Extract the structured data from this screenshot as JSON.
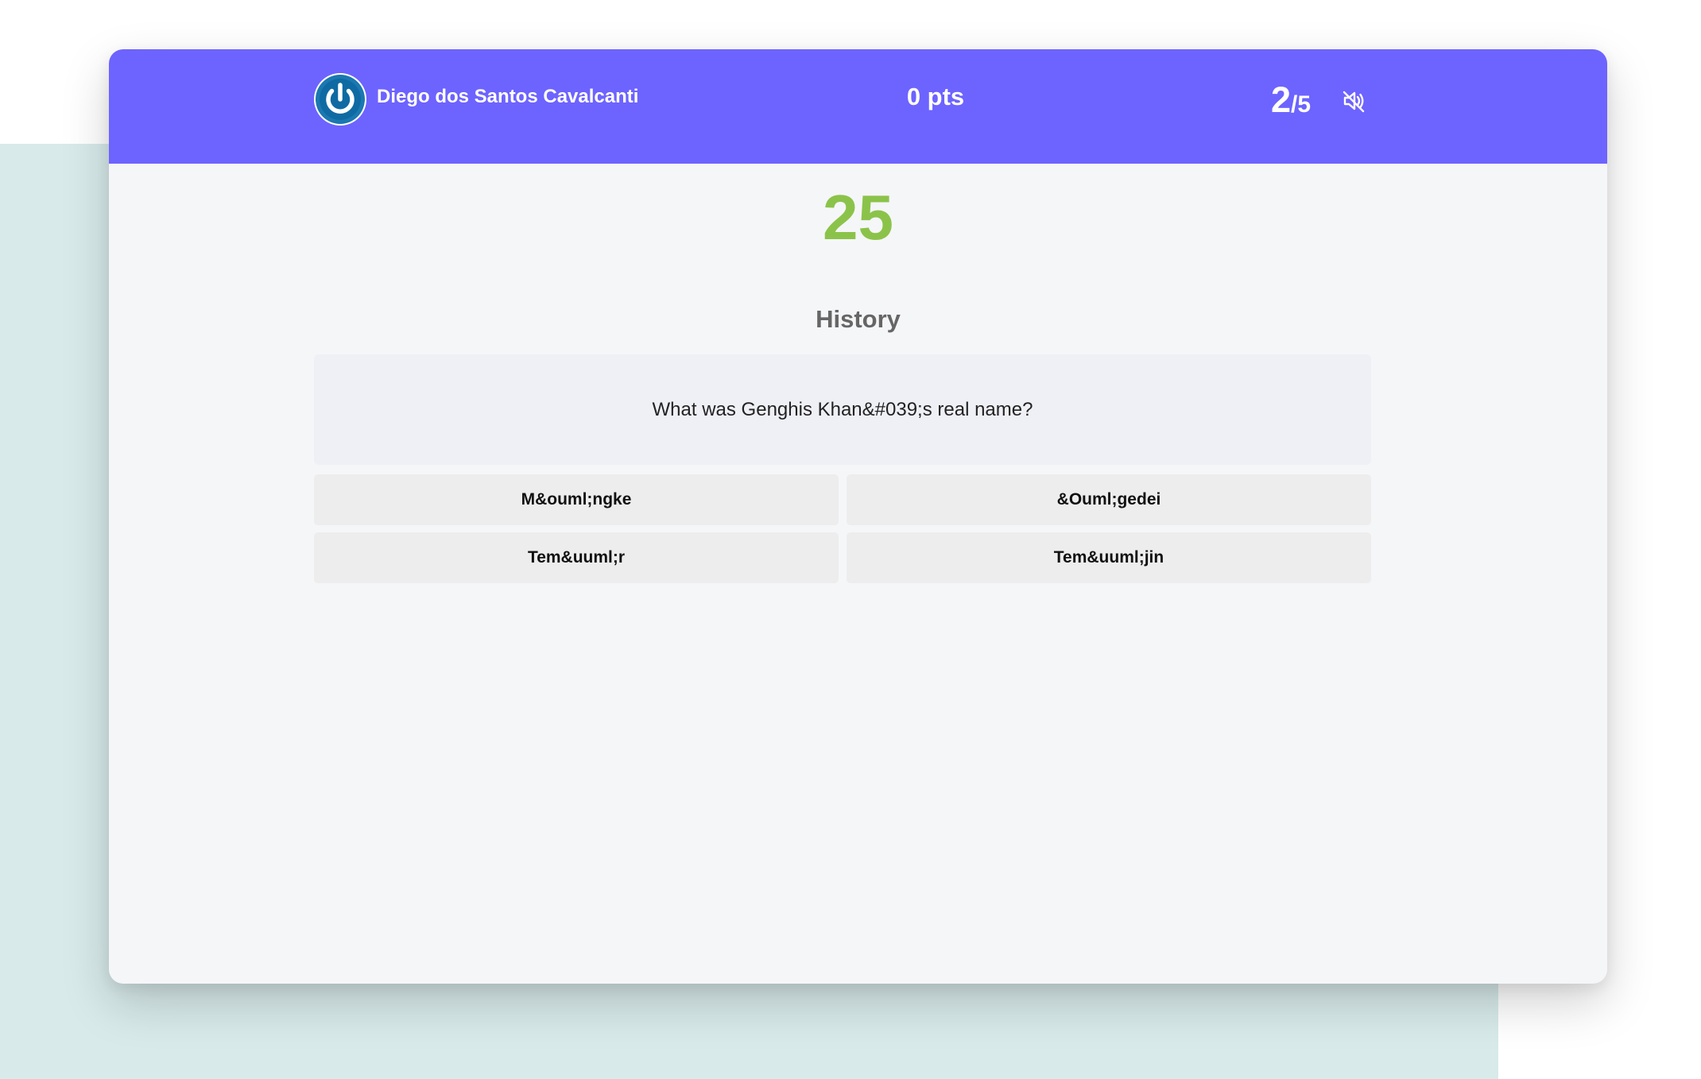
{
  "header": {
    "user_name": "Diego dos Santos Cavalcanti",
    "points": "0 pts",
    "question_current": "2",
    "question_total": "/5",
    "logout_icon": "power-icon",
    "mute_icon": "volume-muted-icon",
    "accent_color": "#6d63ff"
  },
  "main": {
    "timer": "25",
    "timer_color": "#8bc34a",
    "category": "History",
    "question": "What was Genghis Khan&#039;s real name?",
    "answers": [
      {
        "label": "M&ouml;ngke"
      },
      {
        "label": "&Ouml;gedei"
      },
      {
        "label": "Tem&uuml;r"
      },
      {
        "label": "Tem&uuml;jin"
      }
    ]
  }
}
